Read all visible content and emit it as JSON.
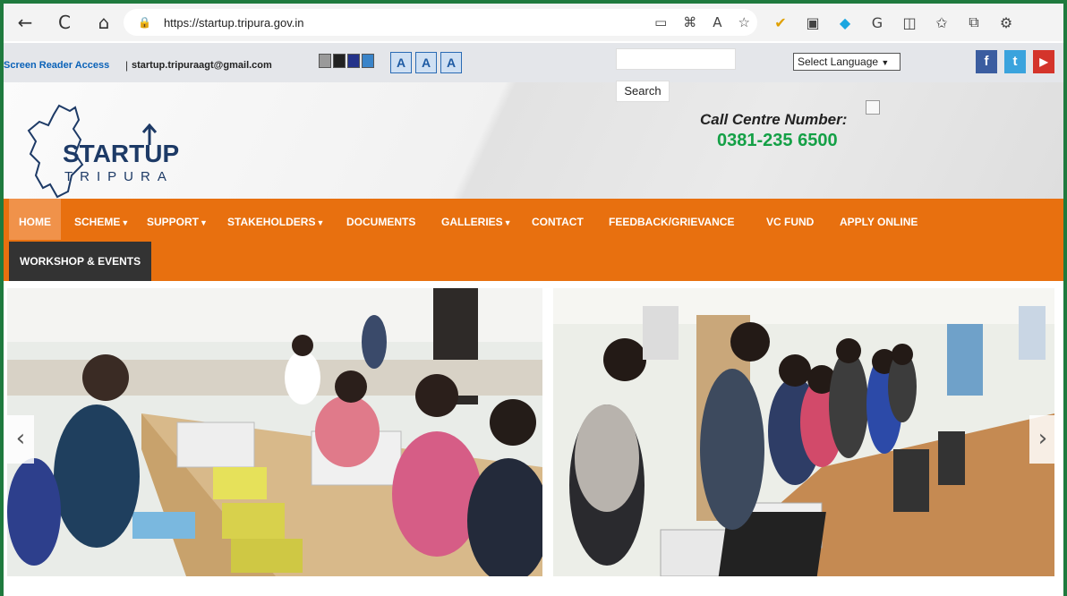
{
  "browser": {
    "url": "https://startup.tripura.gov.in",
    "back_icon": "←",
    "refresh_icon": "C",
    "home_icon": "⌂"
  },
  "topbar": {
    "screen_reader": "Screen Reader Access",
    "separator": "|",
    "email": "startup.tripuraagt@gmail.com",
    "font_buttons": [
      "A",
      "A",
      "A"
    ],
    "search_button": "Search",
    "language": "Select Language",
    "social": {
      "facebook": "f",
      "twitter": "t",
      "youtube": "▶"
    }
  },
  "header": {
    "logo_line1": "STARTUP",
    "logo_line2": "TRIPURA",
    "call_label": "Call Centre Number:",
    "call_number": "0381-235 6500"
  },
  "nav": {
    "items": [
      {
        "label": "HOME"
      },
      {
        "label": "SCHEME"
      },
      {
        "label": "SUPPORT"
      },
      {
        "label": "STAKEHOLDERS"
      },
      {
        "label": "DOCUMENTS"
      },
      {
        "label": "GALLERIES"
      },
      {
        "label": "CONTACT"
      },
      {
        "label": "FEEDBACK/GRIEVANCE"
      },
      {
        "label": "VC FUND"
      },
      {
        "label": "APPLY ONLINE"
      },
      {
        "label": "WORKSHOP & EVENTS"
      }
    ],
    "dropdown_caret": "▼"
  },
  "slider": {
    "prev_icon": "‹",
    "next_icon": "›"
  },
  "colors": {
    "nav_bg": "#e8700f",
    "nav_active": "#f0924a",
    "nav_dark": "#333333",
    "call_number": "#14a046",
    "reader_link": "#0a62b8"
  }
}
